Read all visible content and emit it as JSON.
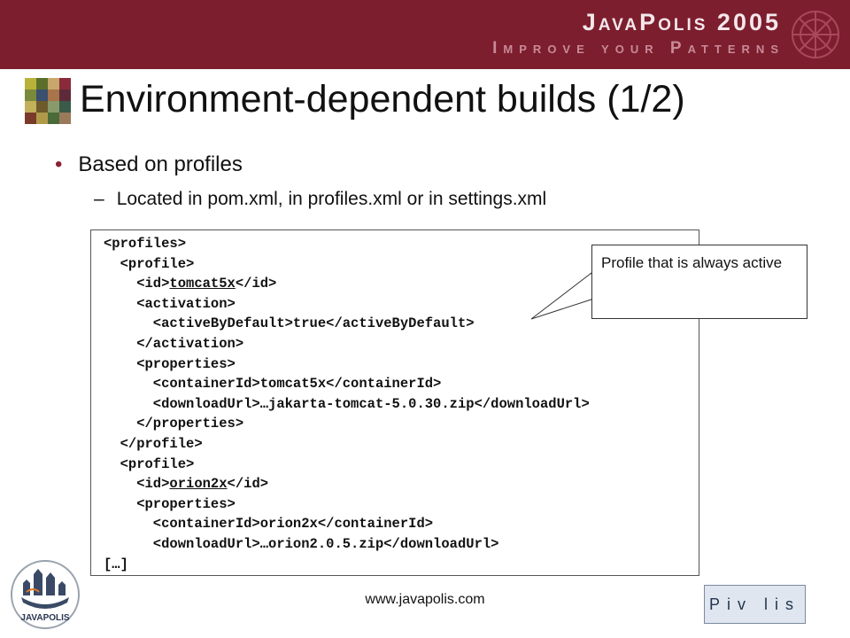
{
  "header": {
    "brand_title": "JavaPolis 2005",
    "brand_tagline": "Improve your Patterns"
  },
  "title": "Environment-dependent builds (1/2)",
  "bullets": {
    "level1": "Based on profiles",
    "level2": "Located in pom.xml, in profiles.xml or in settings.xml",
    "bullet_char": "•",
    "dash_char": "–"
  },
  "code": {
    "lines": [
      {
        "pre": "<profiles>",
        "u": "",
        "post": ""
      },
      {
        "pre": "  <profile>",
        "u": "",
        "post": ""
      },
      {
        "pre": "    <id>",
        "u": "tomcat5x",
        "post": "</id>"
      },
      {
        "pre": "    <activation>",
        "u": "",
        "post": ""
      },
      {
        "pre": "      <activeByDefault>true</activeByDefault>",
        "u": "",
        "post": ""
      },
      {
        "pre": "    </activation>",
        "u": "",
        "post": ""
      },
      {
        "pre": "    <properties>",
        "u": "",
        "post": ""
      },
      {
        "pre": "      <containerId>tomcat5x</containerId>",
        "u": "",
        "post": ""
      },
      {
        "pre": "      <downloadUrl>…jakarta-tomcat-5.0.30.zip</downloadUrl>",
        "u": "",
        "post": ""
      },
      {
        "pre": "    </properties>",
        "u": "",
        "post": ""
      },
      {
        "pre": "  </profile>",
        "u": "",
        "post": ""
      },
      {
        "pre": "  <profile>",
        "u": "",
        "post": ""
      },
      {
        "pre": "    <id>",
        "u": "orion2x",
        "post": "</id>"
      },
      {
        "pre": "    <properties>",
        "u": "",
        "post": ""
      },
      {
        "pre": "      <containerId>orion2x</containerId>",
        "u": "",
        "post": ""
      },
      {
        "pre": "      <downloadUrl>…orion2.0.5.zip</downloadUrl>",
        "u": "",
        "post": ""
      },
      {
        "pre": "[…]",
        "u": "",
        "post": ""
      }
    ]
  },
  "callout": "Profile that is always active",
  "footer": {
    "url": "www.javapolis.com",
    "left_logo_text": "JAVAPOLIS",
    "right_logo_text": "Piv lis"
  },
  "colors": {
    "header": "#7c1e2e",
    "bullet": "#8b2133"
  }
}
